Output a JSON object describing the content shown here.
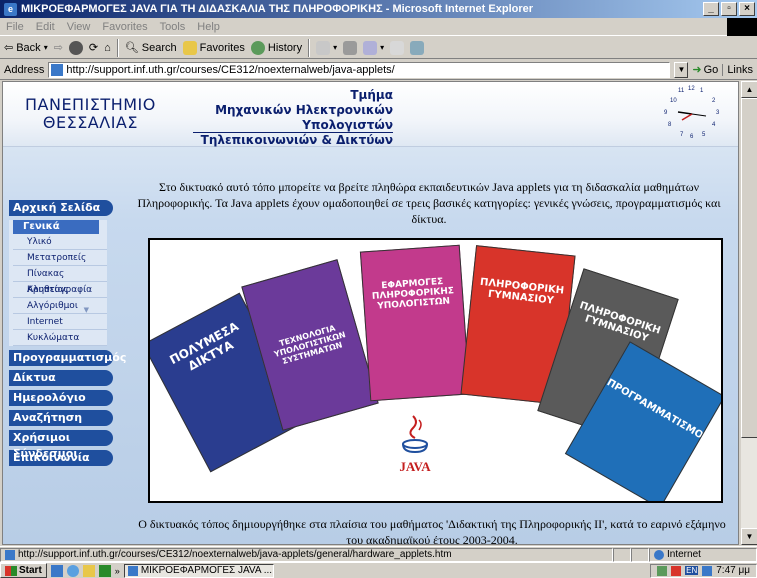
{
  "window": {
    "title": "ΜΙΚΡΟΕΦΑΡΜΟΓΕΣ JAVA ΓΙΑ ΤΗ ΔΙΔΑΣΚΑΛΙΑ ΤΗΣ ΠΛΗΡΟΦΟΡΙΚΗΣ - Microsoft Internet Explorer"
  },
  "menu": [
    "File",
    "Edit",
    "View",
    "Favorites",
    "Tools",
    "Help"
  ],
  "toolbar": {
    "back": "Back",
    "search": "Search",
    "favorites": "Favorites",
    "history": "History"
  },
  "address": {
    "label": "Address",
    "url": "http://support.inf.uth.gr/courses/CE312/noexternalweb/java-applets/",
    "go": "Go",
    "links": "Links"
  },
  "header": {
    "university_line1": "ΠΑΝΕΠΙΣΤΗΜΙΟ",
    "university_line2": "ΘΕΣΣΑΛΙΑΣ",
    "dept_line1": "Τμήμα",
    "dept_line2": "Μηχανικών Ηλεκτρονικών Υπολογιστών",
    "dept_line3": "Τηλεπικοινωνιών & Δικτύων"
  },
  "clock": {
    "numbers": [
      "11",
      "12",
      "1",
      "10",
      "2",
      "9",
      "3",
      "8",
      "4",
      "7",
      "6",
      "5"
    ]
  },
  "sidebar": {
    "home": "Αρχική Σελίδα",
    "general": "Γενικά",
    "sub_items": [
      "Υλικό",
      "Μετατροπείς",
      "Πίνακας Αληθείας",
      "Κρυπτογραφία",
      "Αλγόριθμοι",
      "Internet",
      "Κυκλώματα"
    ],
    "items": [
      "Προγραμματισμός",
      "Δίκτυα",
      "Ημερολόγιο",
      "Αναζήτηση",
      "Χρήσιμοι Σύνδεσμοι",
      "Επικοινωνία"
    ]
  },
  "main": {
    "intro": "Στο δικτυακό αυτό τόπο μπορείτε να βρείτε πληθώρα εκπαιδευτικών Java applets για τη διδασκαλία μαθημάτων Πληροφορικής. Τα Java applets έχουν ομαδοποιηθεί σε τρεις βασικές κατηγορίες: γενικές γνώσεις, προγραμματισμός και δίκτυα.",
    "footer": "Ο δικτυακός τόπος δημιουργήθηκε στα πλαίσια του μαθήματος 'Διδακτική της Πληροφορικής ΙΙ', κατά το εαρινό εξάμηνο του ακαδημαϊκού έτους 2003-2004.",
    "java_label": "JAVA",
    "books": [
      {
        "text": "ΠΟΛΥΜΕΣΑ ΔΙΚΤΥΑ",
        "color": "#2a3d8f"
      },
      {
        "text": "ΤΕΧΝΟΛΟΓΙΑ ΥΠΟΛΟΓΙΣΤΙΚΩΝ ΣΥΣΤΗΜΑΤΩΝ",
        "color": "#6b3a9a"
      },
      {
        "text": "ΕΦΑΡΜΟΓΕΣ ΠΛΗΡΟΦΟΡΙΚΗΣ ΥΠΟΛΟΓΙΣΤΩΝ",
        "color": "#c23a8c"
      },
      {
        "text": "ΠΛΗΡΟΦΟΡΙΚΗ ΓΥΜΝΑΣΙΟΥ",
        "color": "#d8342a"
      },
      {
        "text": "ΠΛΗΡΟΦΟΡΙΚΗ ΓΥΜΝΑΣΙΟΥ",
        "color": "#5a5a5a"
      },
      {
        "text": "ΠΡΟΓΡΑΜΜΑΤΙΣΜΟΣ",
        "color": "#1f6fb8"
      }
    ]
  },
  "status": {
    "url": "http://support.inf.uth.gr/courses/CE312/noexternalweb/java-applets/general/hardware_applets.htm",
    "zone": "Internet"
  },
  "taskbar": {
    "start": "Start",
    "task": "ΜΙΚΡΟΕΦΑΡΜΟΓΕΣ JAVA ...",
    "lang": "EN",
    "time": "7:47 μμ"
  }
}
